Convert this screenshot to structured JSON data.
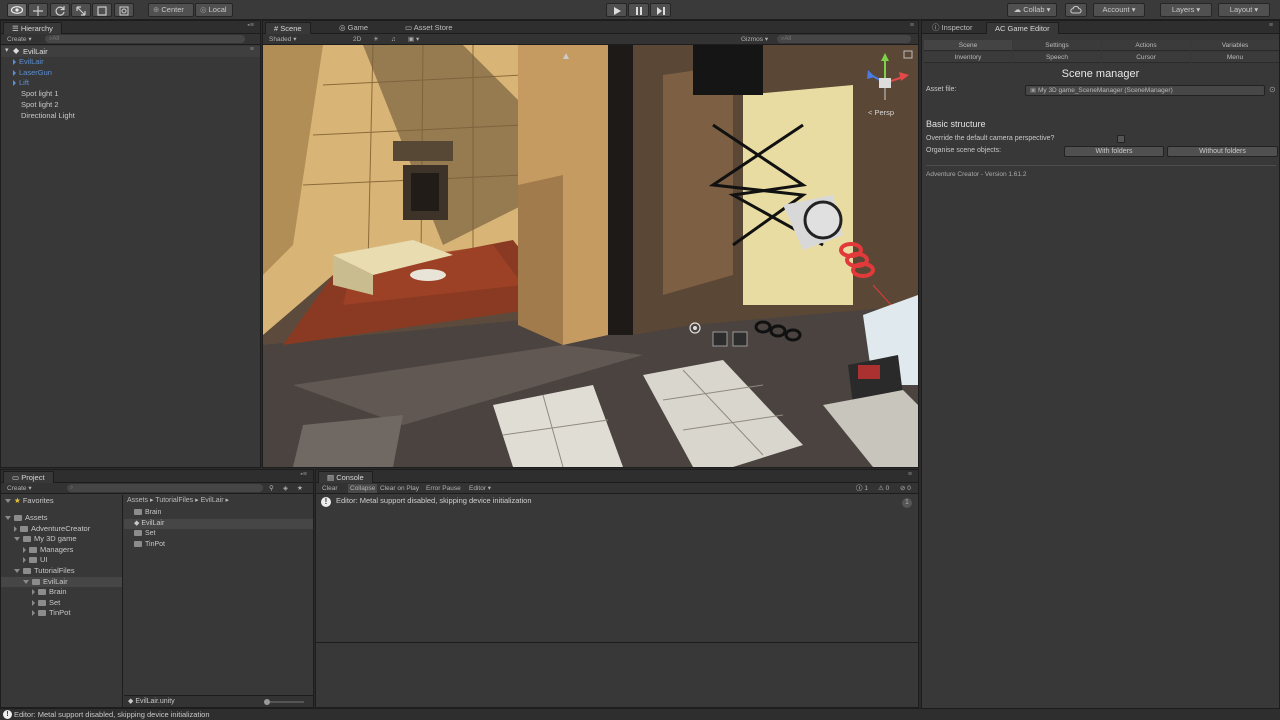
{
  "toolbar": {
    "pivot_label": "Center",
    "space_label": "Local",
    "collab_label": "Collab",
    "account_label": "Account",
    "layers_label": "Layers",
    "layout_label": "Layout"
  },
  "hierarchy": {
    "tab_label": "Hierarchy",
    "create_label": "Create",
    "search_placeholder": "All",
    "scene_name": "EvilLair",
    "items": [
      {
        "label": "EvilLair",
        "color": "#5a8fd6"
      },
      {
        "label": "LaserGun",
        "color": "#5a8fd6"
      },
      {
        "label": "Lift",
        "color": "#5a8fd6"
      },
      {
        "label": "Spot light 1",
        "color": "#c8c8c8"
      },
      {
        "label": "Spot light 2",
        "color": "#c8c8c8"
      },
      {
        "label": "Directional Light",
        "color": "#c8c8c8"
      }
    ]
  },
  "scene_view": {
    "tabs": [
      "Scene",
      "Game",
      "Asset Store"
    ],
    "shading_label": "Shaded",
    "mode_2d_label": "2D",
    "gizmos_label": "Gizmos",
    "search_placeholder": "All",
    "persp_label": "Persp"
  },
  "inspector": {
    "tabs": [
      "Inspector",
      "AC Game Editor"
    ],
    "nav_row1": [
      "Scene",
      "Settings",
      "Actions",
      "Variables"
    ],
    "nav_row2": [
      "Inventory",
      "Speech",
      "Cursor",
      "Menu"
    ],
    "title": "Scene manager",
    "asset_file_label": "Asset file:",
    "asset_file_value": "My 3D game_SceneManager (SceneManager)",
    "section_heading": "Basic structure",
    "override_label": "Override the default camera perspective?",
    "organise_label": "Organise scene objects:",
    "with_folders_label": "With folders",
    "without_folders_label": "Without folders",
    "version_label": "Adventure Creator - Version 1.61.2"
  },
  "project": {
    "tab_label": "Project",
    "create_label": "Create",
    "favorites_label": "Favorites",
    "tree": [
      {
        "label": "Assets",
        "depth": 0,
        "open": true
      },
      {
        "label": "AdventureCreator",
        "depth": 1,
        "open": false
      },
      {
        "label": "My 3D game",
        "depth": 1,
        "open": true
      },
      {
        "label": "Managers",
        "depth": 2,
        "open": false
      },
      {
        "label": "UI",
        "depth": 2,
        "open": false
      },
      {
        "label": "TutorialFiles",
        "depth": 1,
        "open": true
      },
      {
        "label": "EvilLair",
        "depth": 2,
        "open": true
      },
      {
        "label": "Brain",
        "depth": 3,
        "open": false
      },
      {
        "label": "Set",
        "depth": 3,
        "open": false
      },
      {
        "label": "TinPot",
        "depth": 3,
        "open": false
      }
    ],
    "breadcrumb": [
      "Assets",
      "TutorialFiles",
      "EvilLair"
    ],
    "files": [
      "Brain",
      "EvilLair",
      "Set",
      "TinPot"
    ],
    "selected_file_footer": "EvilLair.unity"
  },
  "console": {
    "tab_label": "Console",
    "buttons": [
      "Clear",
      "Collapse",
      "Clear on Play",
      "Error Pause",
      "Editor"
    ],
    "counts": [
      "1",
      "0",
      "0"
    ],
    "message": "Editor: Metal support disabled, skipping device initialization"
  },
  "status_bar": {
    "message": "Editor: Metal support disabled, skipping device initialization"
  }
}
